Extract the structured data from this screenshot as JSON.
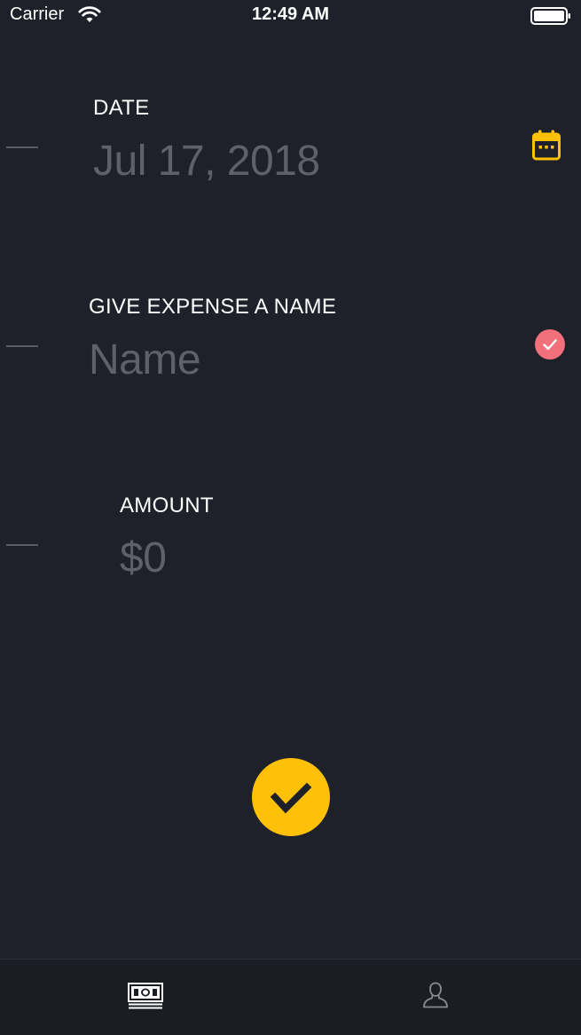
{
  "status_bar": {
    "carrier": "Carrier",
    "time": "12:49 AM"
  },
  "form": {
    "date": {
      "label": "DATE",
      "value": "Jul 17, 2018",
      "icon": "calendar-icon"
    },
    "name": {
      "label": "GIVE EXPENSE A NAME",
      "placeholder": "Name",
      "status_icon": "checkmark-badge-icon"
    },
    "amount": {
      "label": "AMOUNT",
      "placeholder": "$0"
    },
    "submit_icon": "checkmark-icon"
  },
  "tab_bar": {
    "tabs": [
      {
        "icon": "money-icon",
        "selected": true
      },
      {
        "icon": "person-icon",
        "selected": false
      }
    ]
  },
  "colors": {
    "background": "#1e202a",
    "accent": "#ffc107",
    "badge": "#f2707a",
    "placeholder": "#5f6068"
  }
}
